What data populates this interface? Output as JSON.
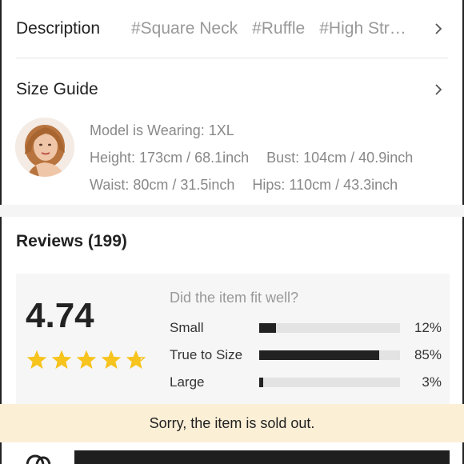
{
  "description": {
    "title": "Description",
    "tags": [
      "#Square Neck",
      "#Ruffle",
      "#High Str…"
    ]
  },
  "size_guide": {
    "title": "Size Guide",
    "model_wearing": "Model is Wearing: 1XL",
    "height": "Height: 173cm / 68.1inch",
    "bust": "Bust: 104cm / 40.9inch",
    "waist": "Waist: 80cm / 31.5inch",
    "hips": "Hips: 110cm / 43.3inch"
  },
  "reviews": {
    "title": "Reviews (199)",
    "rating": "4.74",
    "rating_value": 4.74,
    "stars_max": 5,
    "star_color": "#f7c31d",
    "fit_question": "Did the item fit well?",
    "fit": [
      {
        "label": "Small",
        "percent_text": "12%",
        "percent": 12
      },
      {
        "label": "True to Size",
        "percent_text": "85%",
        "percent": 85
      },
      {
        "label": "Large",
        "percent_text": "3%",
        "percent": 3
      }
    ]
  },
  "banner": {
    "sold_out": "Sorry, the item is sold out.",
    "background": "#fbefd6"
  }
}
